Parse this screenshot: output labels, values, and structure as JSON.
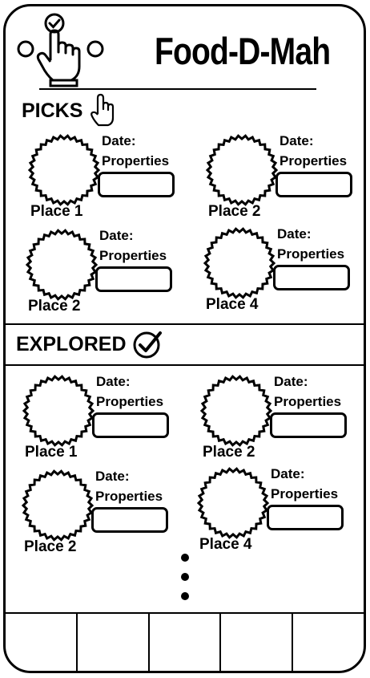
{
  "app": {
    "title": "Food-D-Mah",
    "logo_icon": "tap-hand-check-icon"
  },
  "picks": {
    "title": "PICKS",
    "icon": "pointer-hand-icon",
    "cards": [
      {
        "place": "Place 1",
        "date_label": "Date:",
        "properties_label": "Properties",
        "properties_value": ""
      },
      {
        "place": "Place 2",
        "date_label": "Date:",
        "properties_label": "Properties",
        "properties_value": ""
      },
      {
        "place": "Place 2",
        "date_label": "Date:",
        "properties_label": "Properties",
        "properties_value": ""
      },
      {
        "place": "Place 4",
        "date_label": "Date:",
        "properties_label": "Properties",
        "properties_value": ""
      }
    ]
  },
  "explored": {
    "title": "EXPLORED",
    "icon": "check-circle-icon",
    "cards": [
      {
        "place": "Place 1",
        "date_label": "Date:",
        "properties_label": "Properties",
        "properties_value": ""
      },
      {
        "place": "Place 2",
        "date_label": "Date:",
        "properties_label": "Properties",
        "properties_value": ""
      },
      {
        "place": "Place 2",
        "date_label": "Date:",
        "properties_label": "Properties",
        "properties_value": ""
      },
      {
        "place": "Place 4",
        "date_label": "Date:",
        "properties_label": "Properties",
        "properties_value": ""
      }
    ],
    "more_indicator": "vertical-ellipsis-icon"
  },
  "tab_bar": {
    "tab_count": 5
  },
  "colors": {
    "ink": "#000000",
    "background": "#ffffff"
  }
}
